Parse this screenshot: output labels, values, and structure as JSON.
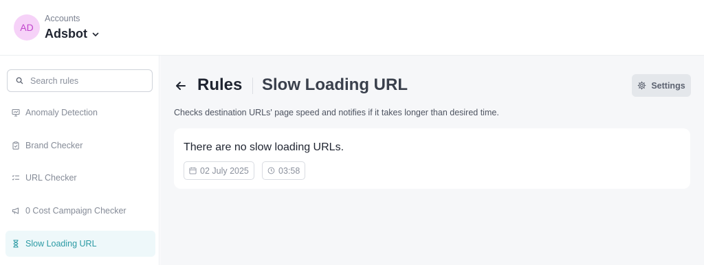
{
  "header": {
    "avatar_initials": "AD",
    "account_label": "Accounts",
    "account_name": "Adsbot"
  },
  "sidebar": {
    "search_placeholder": "Search rules",
    "items": [
      {
        "label": "Anomaly Detection",
        "icon": "chart-monitor-icon",
        "active": false
      },
      {
        "label": "Brand Checker",
        "icon": "clipboard-check-icon",
        "active": false
      },
      {
        "label": "URL Checker",
        "icon": "checklist-icon",
        "active": false
      },
      {
        "label": "0 Cost Campaign Checker",
        "icon": "megaphone-icon",
        "active": false
      },
      {
        "label": "Slow Loading URL",
        "icon": "hourglass-icon",
        "active": true
      }
    ]
  },
  "main": {
    "title": "Rules",
    "subtitle": "Slow Loading URL",
    "settings_label": "Settings",
    "description": "Checks destination URLs' page speed and notifies if it takes longer than desired time.",
    "card": {
      "message": "There are no slow loading URLs.",
      "date": "02 July 2025",
      "time": "03:58"
    }
  },
  "colors": {
    "accent": "#2b9aa4",
    "accent_bg": "#eef8fa",
    "avatar_bg": "#f6d2f8",
    "avatar_text": "#c146cc"
  }
}
